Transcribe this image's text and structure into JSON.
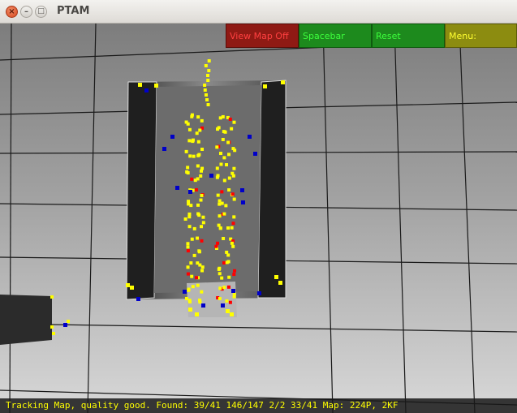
{
  "window": {
    "title": "PTAM"
  },
  "window_controls": {
    "close_glyph": "×",
    "minimize_glyph": "–",
    "maximize_glyph": "□"
  },
  "menu": {
    "view_map": "View Map Off",
    "spacebar": "Spacebar",
    "reset": "Reset",
    "menu": "Menu:"
  },
  "status": {
    "text": "Tracking Map, quality good. Found: 39/41 146/147 2/2 33/41 Map: 224P, 2KF"
  },
  "colors": {
    "feature_yellow": "#ffff00",
    "feature_red": "#ff0000",
    "feature_blue": "#0000c8",
    "status_text": "#ffff00"
  }
}
